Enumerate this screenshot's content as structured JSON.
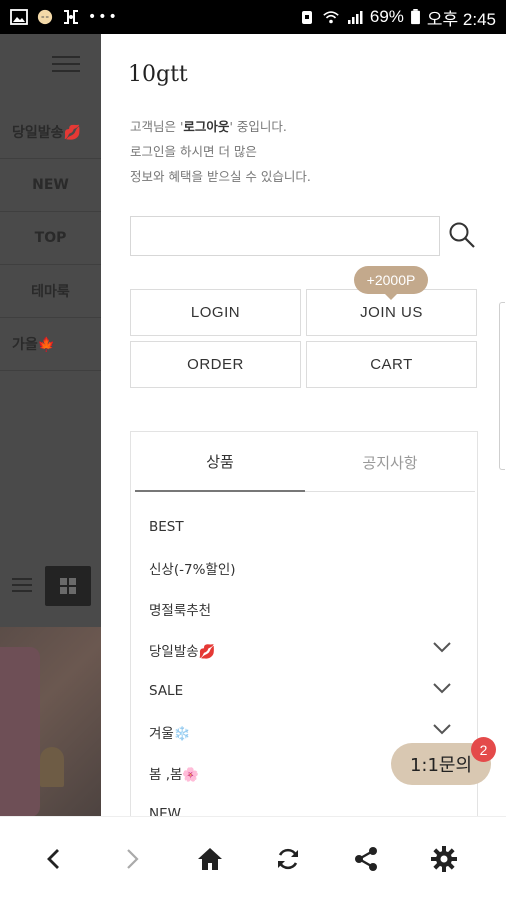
{
  "status_bar": {
    "battery": "69%",
    "time": "오후 2:45",
    "icons": [
      "image-icon",
      "emoji-icon",
      "bracket-icon",
      "more-icon",
      "alarm-icon",
      "wifi-icon",
      "signal-icon",
      "battery-icon"
    ]
  },
  "background_page": {
    "nav_items": [
      "당일발송💋",
      "NEW",
      "TOP",
      "테마룩",
      "가을🍁"
    ]
  },
  "drawer": {
    "logo": "10gtt",
    "greeting_prefix": "고객님은 '",
    "greeting_status": "로그아웃",
    "greeting_suffix": "' 중입니다.",
    "greeting_line2": "로그인을 하시면 더 많은",
    "greeting_line3": "정보와 혜택을 받으실 수 있습니다.",
    "search": {
      "placeholder": ""
    },
    "buttons": {
      "login": "LOGIN",
      "join": "JOIN US",
      "order": "ORDER",
      "cart": "CART"
    },
    "join_bonus": "+2000P",
    "tabs": {
      "products": "상품",
      "notice": "공지사항"
    },
    "categories": [
      {
        "label": "BEST",
        "expandable": false
      },
      {
        "label": "신상(-7%할인)",
        "expandable": false
      },
      {
        "label": "명절룩추천",
        "expandable": false
      },
      {
        "label": "당일발송💋",
        "expandable": true
      },
      {
        "label": "SALE",
        "expandable": true
      },
      {
        "label": "겨울❄️",
        "expandable": true
      },
      {
        "label": "봄 ,봄🌸",
        "expandable": false
      },
      {
        "label": "NEW",
        "expandable": false
      }
    ]
  },
  "chat": {
    "label": "1:1문의",
    "badge": "2"
  },
  "bottom_nav": {
    "icons": [
      "back-icon",
      "forward-icon",
      "home-icon",
      "refresh-icon",
      "share-icon",
      "settings-icon"
    ]
  },
  "colors": {
    "accent": "#c3a98c",
    "chat_bg": "#d9c8b2",
    "badge": "#e44a4a"
  }
}
